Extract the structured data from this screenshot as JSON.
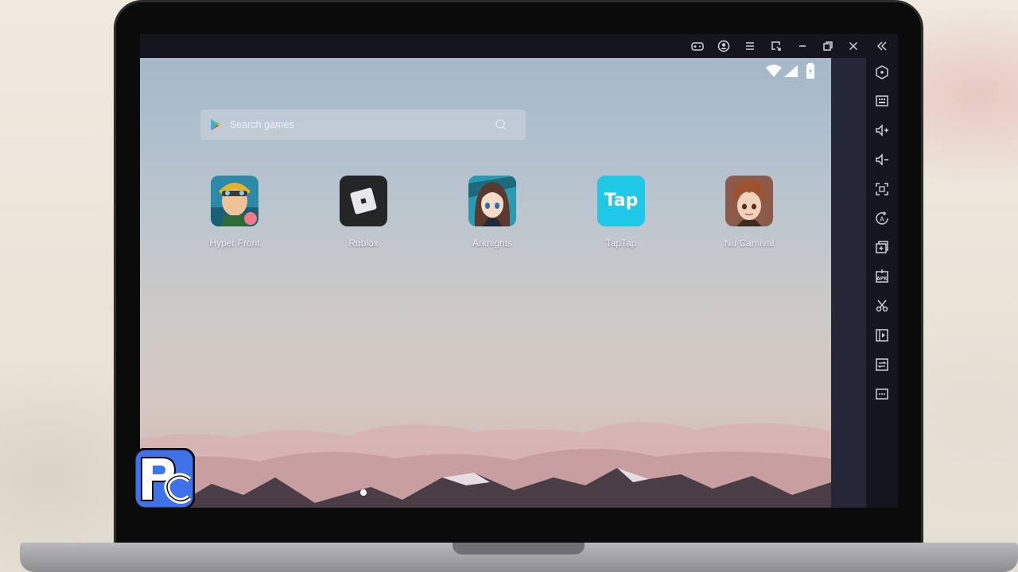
{
  "search": {
    "placeholder": "Search games"
  },
  "apps": [
    {
      "label": "Hyper Front",
      "icon": "hyper-front-app-icon"
    },
    {
      "label": "Roblox",
      "icon": "roblox-app-icon"
    },
    {
      "label": "Arknights",
      "icon": "arknights-app-icon"
    },
    {
      "label": "TapTap",
      "icon": "taptap-app-icon",
      "icon_text": "Tap"
    },
    {
      "label": "Nu Carnival",
      "icon": "nu-carnival-app-icon"
    }
  ],
  "titlebar_icons": [
    "gamepad-icon",
    "account-icon",
    "menu-icon",
    "resize-icon",
    "minimize-icon",
    "restore-icon",
    "close-icon",
    "collapse-sidebar-icon"
  ],
  "sidebar_icons": [
    "home-hexagon-icon",
    "keyboard-icon",
    "volume-up-icon",
    "volume-down-icon",
    "screenshot-icon",
    "auto-rotate-icon",
    "multi-instance-icon",
    "apk-install-icon",
    "scissors-icon",
    "video-record-icon",
    "sync-icon",
    "more-icon"
  ],
  "status_icons": [
    "wifi-icon",
    "signal-icon",
    "battery-charging-icon"
  ],
  "colors": {
    "taptap": "#1ec8e6",
    "roblox": "#232527",
    "logo": "#3f72e8"
  }
}
